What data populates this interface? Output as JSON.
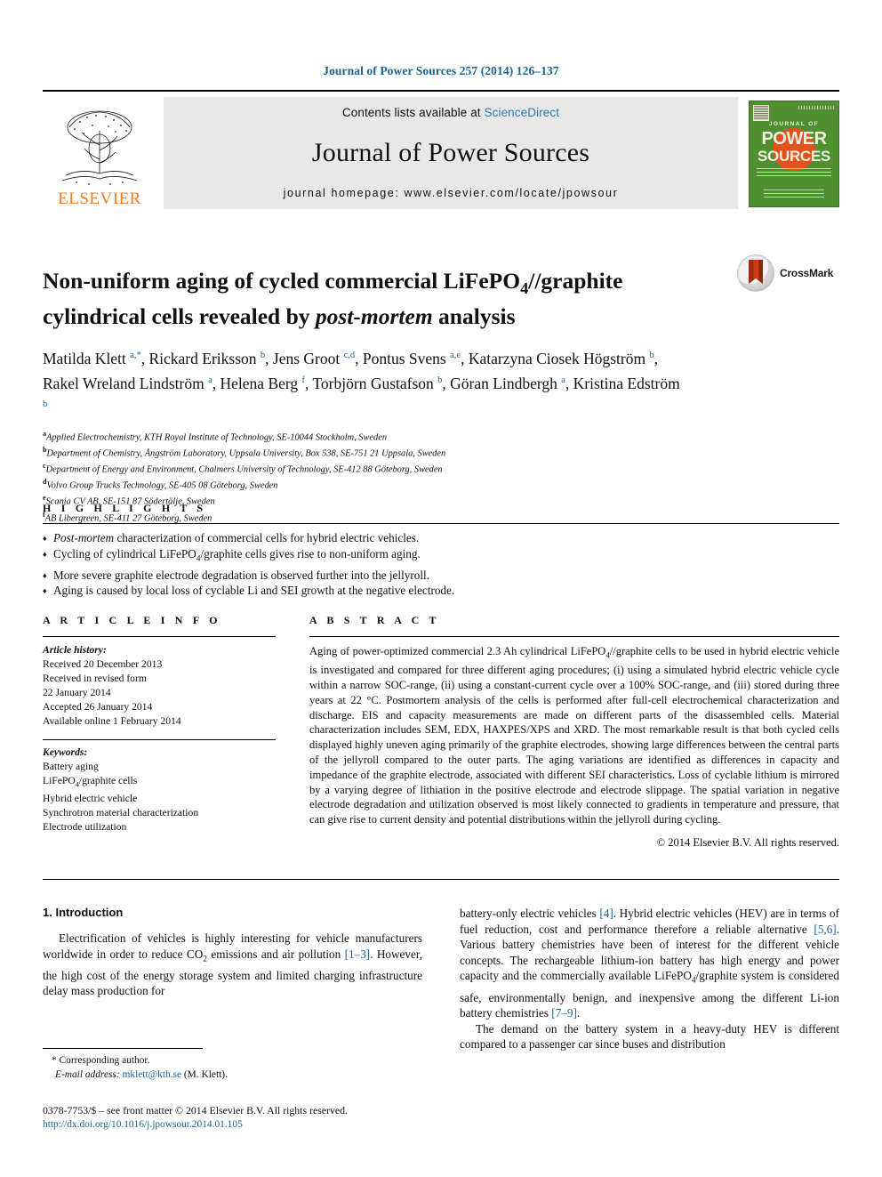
{
  "running_head": "Journal of Power Sources 257 (2014) 126–137",
  "masthead": {
    "publisher_wordmark": "ELSEVIER",
    "contents_prefix": "Contents lists available at ",
    "contents_link": "ScienceDirect",
    "journal_name": "Journal of Power Sources",
    "homepage": "journal homepage: www.elsevier.com/locate/jpowsour",
    "cover": {
      "line1": "JOURNAL OF",
      "line2": "POWER",
      "line3": "SOURCES"
    }
  },
  "article": {
    "title_line1_pre": "Non-uniform aging of cycled commercial LiFePO",
    "title_sub": "4",
    "title_line1_post": "//graphite cylindrical",
    "title_line2_pre": "cells revealed by ",
    "title_line2_em": "post-mortem",
    "title_line2_post": " analysis",
    "crossmark_label": "CrossMark",
    "authors_html": "Matilda Klett <sup>a,*</sup>, Rickard Eriksson <sup>b</sup>, Jens Groot <sup>c,d</sup>, Pontus Svens <sup>a,e</sup>, Katarzyna Ciosek Högström <sup>b</sup>, Rakel Wreland Lindström <sup>a</sup>, Helena Berg <sup>f</sup>, Torbjörn Gustafson <sup>b</sup>, Göran Lindbergh <sup>a</sup>, Kristina Edström <sup>b</sup>",
    "affiliations": [
      {
        "mark": "a",
        "text": "Applied Electrochemistry, KTH Royal Institute of Technology, SE-10044 Stockholm, Sweden"
      },
      {
        "mark": "b",
        "text": "Department of Chemistry, Ångström Laboratory, Uppsala University, Box 538, SE-751 21 Uppsala, Sweden"
      },
      {
        "mark": "c",
        "text": "Department of Energy and Environment, Chalmers University of Technology, SE-412 88 Göteborg, Sweden"
      },
      {
        "mark": "d",
        "text": "Volvo Group Trucks Technology, SE-405 08 Göteborg, Sweden"
      },
      {
        "mark": "e",
        "text": "Scania CV AB, SE-151 87 Södertälje, Sweden"
      },
      {
        "mark": "f",
        "text": "AB Libergreen, SE-411 27 Göteborg, Sweden"
      }
    ]
  },
  "highlights": {
    "label": "H I G H L I G H T S",
    "items_html": [
      "<em>Post-mortem</em> characterization of commercial cells for hybrid electric vehicles.",
      "Cycling of cylindrical LiFePO<sub>4</sub>/graphite cells gives rise to non-uniform aging.",
      "More severe graphite electrode degradation is observed further into the jellyroll.",
      "Aging is caused by local loss of cyclable Li and SEI growth at the negative electrode."
    ]
  },
  "article_info": {
    "label": "A R T I C L E   I N F O",
    "history_label": "Article history:",
    "history": [
      "Received 20 December 2013",
      "Received in revised form",
      "22 January 2014",
      "Accepted 26 January 2014",
      "Available online 1 February 2014"
    ],
    "keywords_label": "Keywords:",
    "keywords_html": [
      "Battery aging",
      "LiFePO<sub>4</sub>/graphite cells",
      "Hybrid electric vehicle",
      "Synchrotron material characterization",
      "Electrode utilization"
    ]
  },
  "abstract": {
    "label": "A B S T R A C T",
    "text_html": "Aging of power-optimized commercial 2.3 Ah cylindrical LiFePO<sub>4</sub>//graphite cells to be used in hybrid electric vehicle is investigated and compared for three different aging procedures; (i) using a simulated hybrid electric vehicle cycle within a narrow SOC-range, (ii) using a constant-current cycle over a 100% SOC-range, and (iii) stored during three years at 22 °C. Postmortem analysis of the cells is performed after full-cell electrochemical characterization and discharge. EIS and capacity measurements are made on different parts of the disassembled cells. Material characterization includes SEM, EDX, HAXPES/XPS and XRD. The most remarkable result is that both cycled cells displayed highly uneven aging primarily of the graphite electrodes, showing large differences between the central parts of the jellyroll compared to the outer parts. The aging variations are identified as differences in capacity and impedance of the graphite electrode, associated with different SEI characteristics. Loss of cyclable lithium is mirrored by a varying degree of lithiation in the positive electrode and electrode slippage. The spatial variation in negative electrode degradation and utilization observed is most likely connected to gradients in temperature and pressure, that can give rise to current density and potential distributions within the jellyroll during cycling.",
    "copyright": "© 2014 Elsevier B.V. All rights reserved."
  },
  "body": {
    "section_number_title": "1.  Introduction",
    "left_paragraph_html": "Electrification of vehicles is highly interesting for vehicle manufacturers worldwide in order to reduce CO<sub>2</sub> emissions and air pollution <span class=\"ref\">[1–3]</span>. However, the high cost of the energy storage system and limited charging infrastructure delay mass production for",
    "right_paragraph1_html": "battery-only electric vehicles <span class=\"ref\">[4]</span>. Hybrid electric vehicles (HEV) are in terms of fuel reduction, cost and performance therefore a reliable alternative <span class=\"ref\">[5,6]</span>. Various battery chemistries have been of interest for the different vehicle concepts. The rechargeable lithium-ion battery has high energy and power capacity and the commercially available LiFePO<sub>4</sub>/graphite system is considered safe, environmentally benign, and inexpensive among the different Li-ion battery chemistries <span class=\"ref\">[7–9]</span>.",
    "right_paragraph2_html": "The demand on the battery system in a heavy-duty HEV is different compared to a passenger car since buses and distribution"
  },
  "footer": {
    "corresponding_label": "* Corresponding author.",
    "email_label": "E-mail address:",
    "email": "mklett@kth.se",
    "email_suffix": "(M. Klett).",
    "issn_line": "0378-7753/$ – see front matter © 2014 Elsevier B.V. All rights reserved.",
    "doi": "http://dx.doi.org/10.1016/j.jpowsour.2014.01.105"
  },
  "colors": {
    "link": "#1a6496",
    "elsevier_orange": "#f07d24",
    "cover_green": "#4f9031",
    "masthead_gray": "#e8e8e8"
  }
}
